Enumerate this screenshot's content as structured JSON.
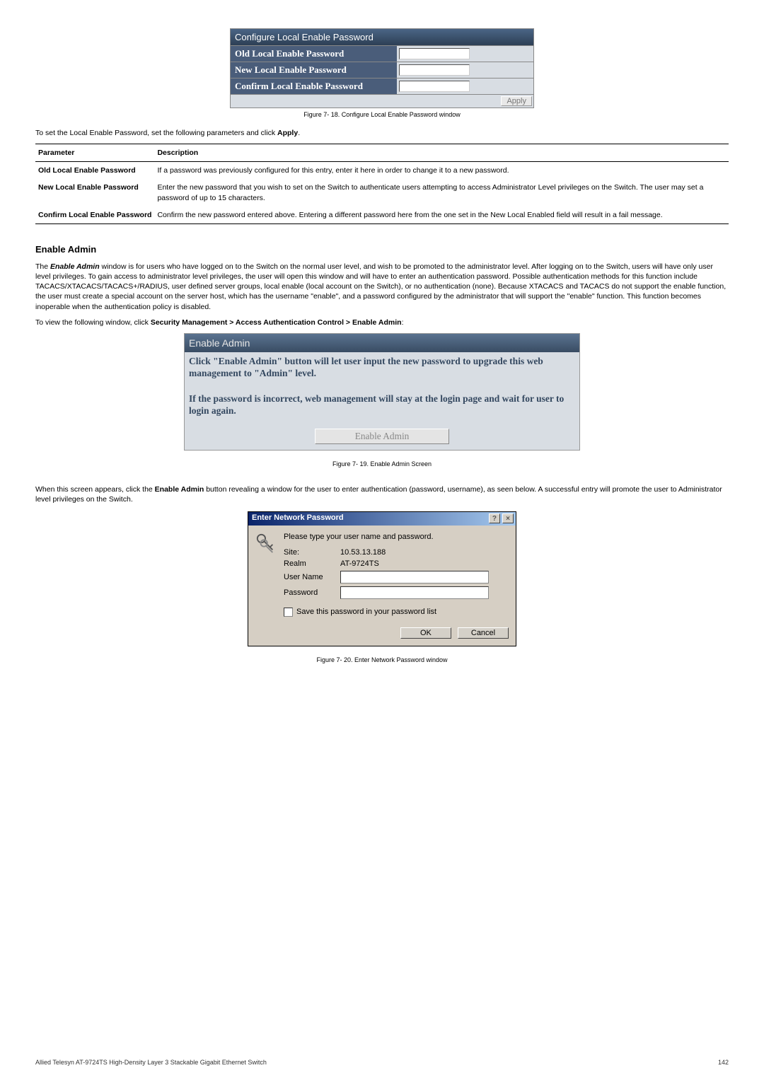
{
  "fig1": {
    "title": "Configure Local Enable Password",
    "row1_label": "Old Local Enable Password",
    "row2_label": "New Local Enable Password",
    "row3_label": "Confirm Local Enable Password",
    "apply": "Apply"
  },
  "caption1": "Figure 7- 18. Configure Local Enable Password window",
  "intro1_a": "To set the Local Enable Password, set the following parameters and click ",
  "intro1_b": "Apply",
  "intro1_c": ".",
  "table": {
    "h1": "Parameter",
    "h2": "Description",
    "r1_name": "Old Local Enable Password",
    "r1_desc": "If a password was previously configured for this entry, enter it here in order to change it to a new password.",
    "r2_name": "New Local Enable Password",
    "r2_desc": "Enter the new password that you wish to set on the Switch to authenticate users attempting to access Administrator Level privileges on the Switch. The user may set a password of up to 15 characters.",
    "r3_name": "Confirm Local Enable Password",
    "r3_desc": "Confirm the new password entered above. Entering a different password here from the one set in the New Local Enabled field will result in a fail message."
  },
  "section_heading": "Enable Admin",
  "para_a": "The ",
  "para_b": "Enable Admin",
  "para_c": " window is for users who have logged on to the Switch on the normal user level, and wish to be promoted to the administrator level. After logging on to the Switch, users will have only user level privileges. To gain access to administrator level privileges, the user will open this window and will have to enter an authentication password. Possible authentication methods for this function include TACACS/XTACACS/TACACS+/RADIUS, user defined server groups, local enable (local account on the Switch), or no authentication (none). Because XTACACS and TACACS do not support the enable function, the user must create a special account on the server host, which has the username \"enable\", and a password configured by the administrator that will support the \"enable\" function. This function becomes inoperable when the authentication policy is disabled.",
  "nav_a": "To view the following window, click ",
  "nav_b": "Security Management > Access Authentication Control > Enable Admin",
  "nav_c": ":",
  "fig2": {
    "title": "Enable Admin",
    "body_1": "Click \"Enable Admin\" button will let user input the new password to upgrade this web management to \"Admin\" level.",
    "body_2": "If the password is incorrect, web management will stay at the login page and wait for user to login again.",
    "button": "Enable Admin"
  },
  "caption2": "Figure 7- 19. Enable Admin Screen",
  "para2_a": "When this screen appears, click the ",
  "para2_b": "Enable Admin",
  "para2_c": " button revealing a window for the user to enter authentication (password, username), as seen below. A successful entry will promote the user to Administrator level privileges on the Switch.",
  "fig3": {
    "title": "Enter Network Password",
    "instr": "Please type your user name and password.",
    "site_label": "Site:",
    "site_value": "10.53.13.188",
    "realm_label": "Realm",
    "realm_value": "AT-9724TS",
    "user_label": "User Name",
    "pass_label": "Password",
    "save_label": "Save this password in your password list",
    "ok": "OK",
    "cancel": "Cancel"
  },
  "caption3": "Figure 7- 20. Enter Network Password window",
  "footer_left": "Allied Telesyn AT-9724TS High-Density Layer 3 Stackable Gigabit Ethernet Switch",
  "footer_right": "142"
}
